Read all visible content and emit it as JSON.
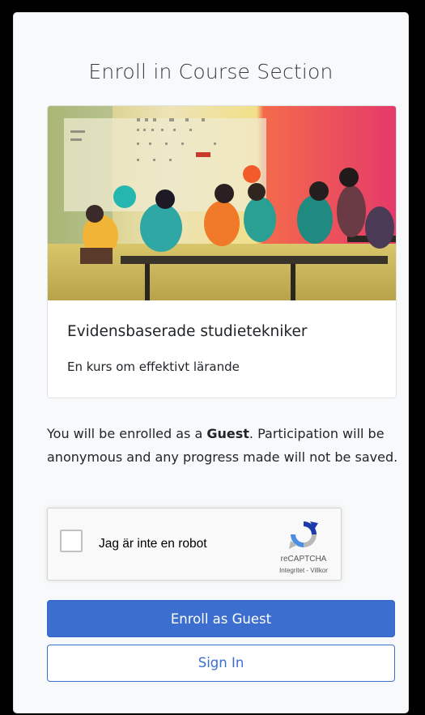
{
  "page": {
    "title": "Enroll in Course Section"
  },
  "course": {
    "title": "Evidensbaserade studietekniker",
    "description": "En kurs om effektivt lärande",
    "image_icon": "classroom-illustration"
  },
  "notice": {
    "before": "You will be enrolled as a ",
    "role": "Guest",
    "after": ". Participation will be anonymous and any progress made will not be saved."
  },
  "recaptcha": {
    "label": "Jag är inte en robot",
    "brand": "reCAPTCHA",
    "links": "Integritet - Villkor"
  },
  "actions": {
    "enroll_label": "Enroll as Guest",
    "signin_label": "Sign In"
  },
  "colors": {
    "primary": "#3c6ecf",
    "panel_bg": "#f8f9fa"
  }
}
